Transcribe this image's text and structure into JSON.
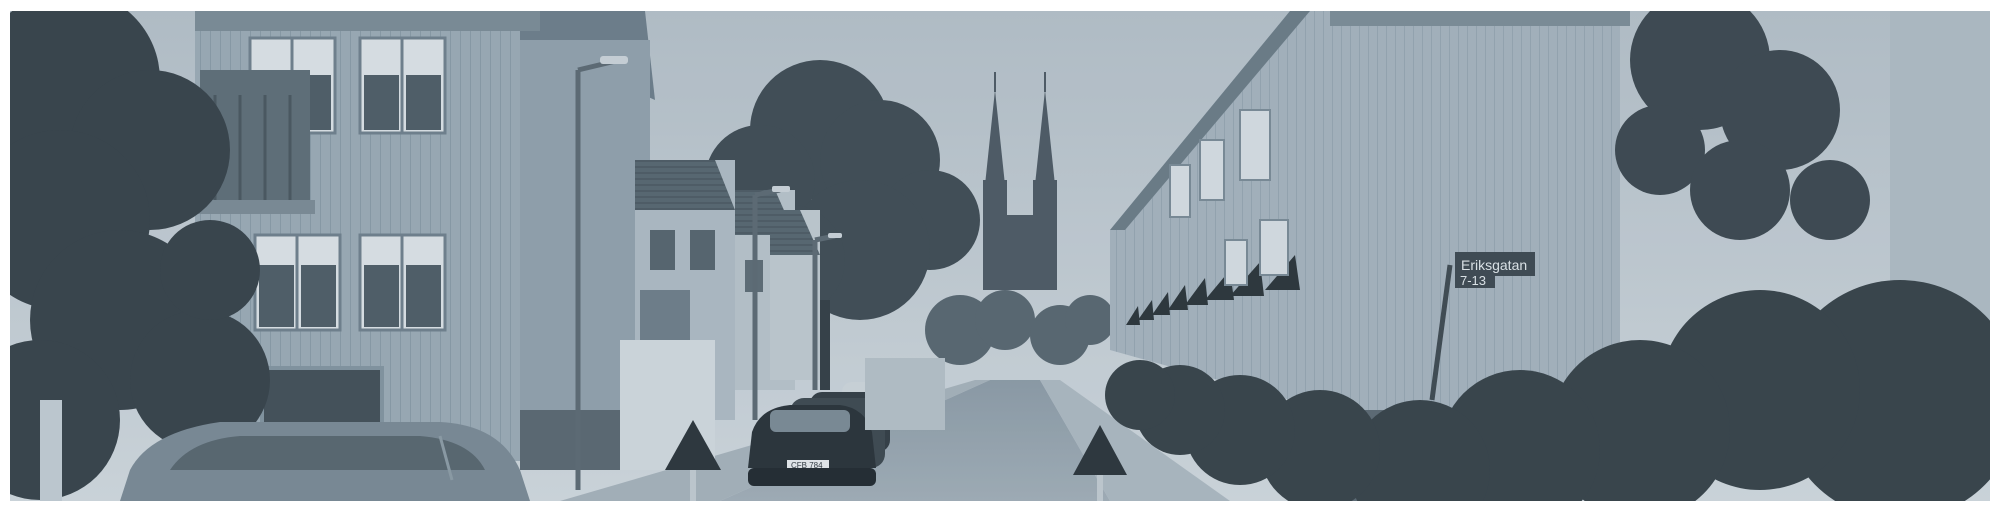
{
  "street_sign": {
    "name": "Eriksgatan",
    "numbers": "7-13"
  },
  "car_plate": "CFB 784",
  "colors": {
    "tint": "#6f8596",
    "sky": "#c7d0d7",
    "foliage": "#39444c",
    "background": "#ffffff"
  }
}
